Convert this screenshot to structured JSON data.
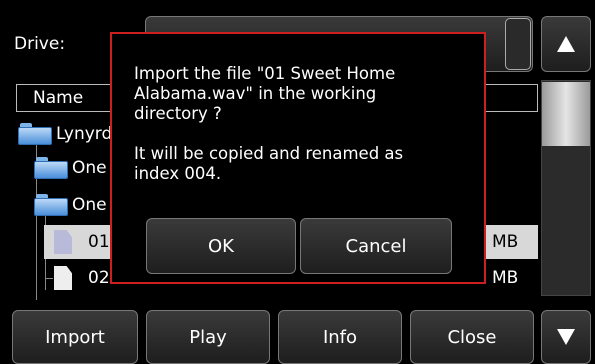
{
  "drive": {
    "label": "Drive:",
    "value": ""
  },
  "list_header": {
    "name": "Name"
  },
  "tree": [
    {
      "label": "Lynyrd",
      "type": "folder"
    },
    {
      "label": "One",
      "type": "folder"
    },
    {
      "label": "One",
      "type": "folder"
    },
    {
      "label": "01",
      "size": "MB",
      "type": "file",
      "selected": true
    },
    {
      "label": "02",
      "size": "MB",
      "type": "file"
    }
  ],
  "scroll": {
    "up_icon": "triangle-up-icon",
    "down_icon": "triangle-down-icon"
  },
  "toolbar": {
    "import_label": "Import",
    "play_label": "Play",
    "info_label": "Info",
    "close_label": "Close"
  },
  "dialog": {
    "line1": "Import the file \"01 Sweet Home",
    "line2": "Alabama.wav\" in the working",
    "line3": "directory ?",
    "line4": "It will be copied and renamed as",
    "line5": "index 004.",
    "ok_label": "OK",
    "cancel_label": "Cancel",
    "border_color": "#cc2020"
  }
}
